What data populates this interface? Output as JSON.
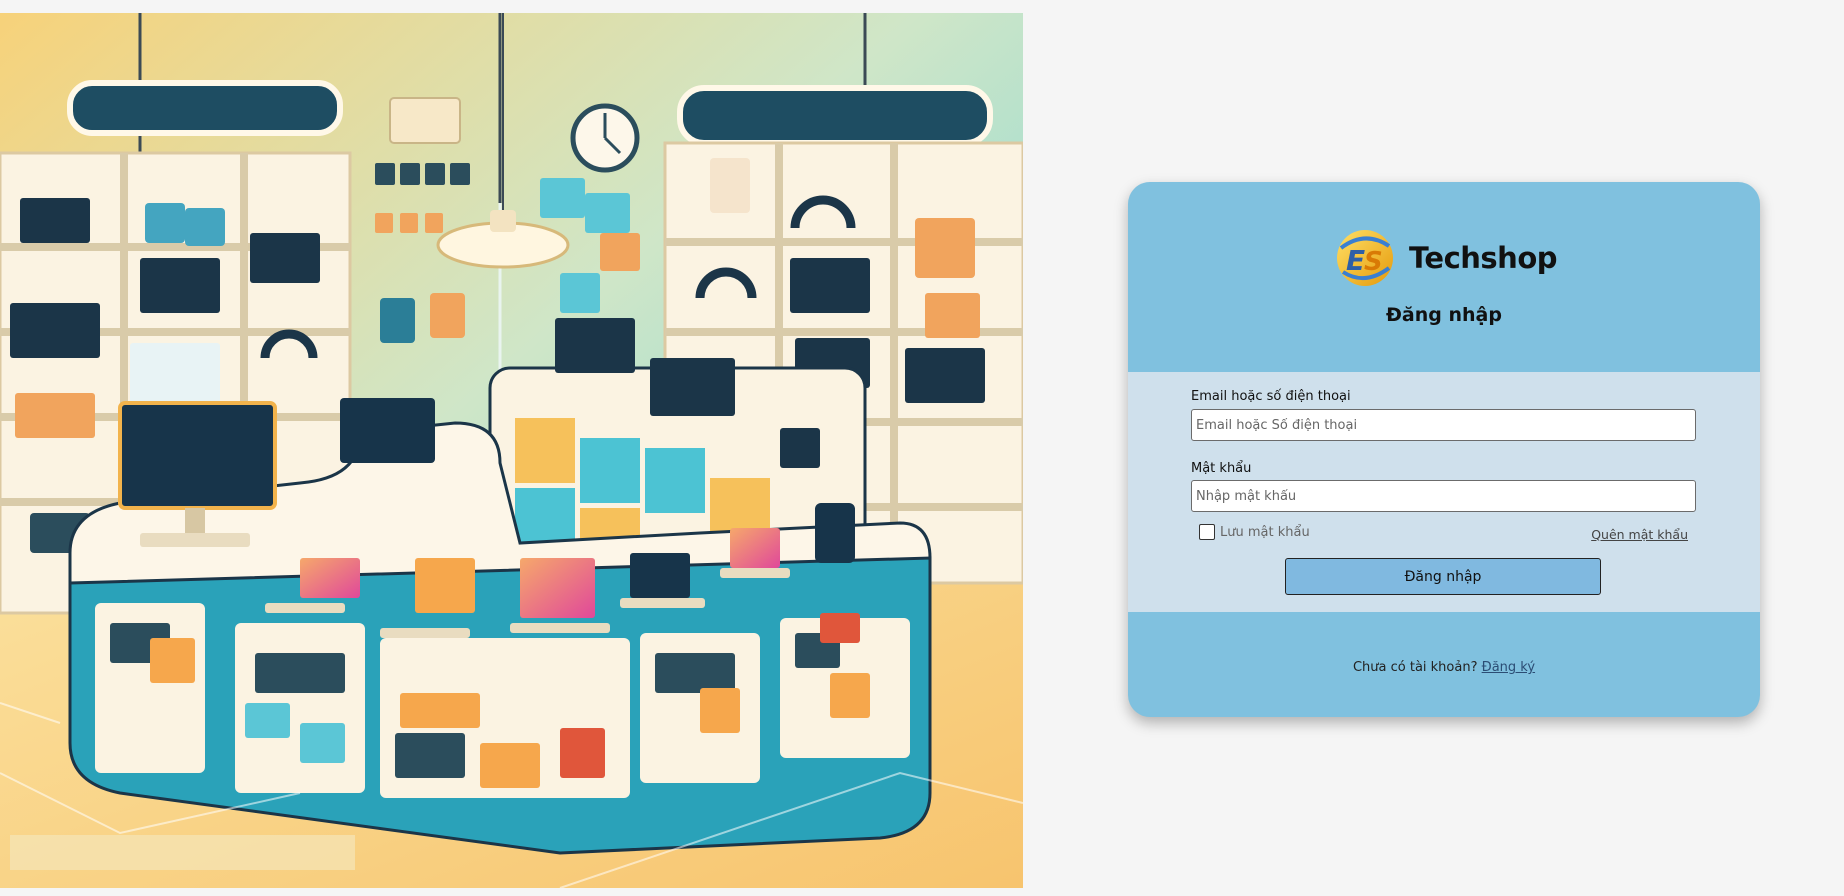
{
  "hero": {
    "alt": "Techshop electronics store illustration"
  },
  "brand": {
    "name": "Techshop",
    "logo_icon": "techshop-logo-icon"
  },
  "login": {
    "title": "Đăng nhập",
    "email_label": "Email hoặc số điện thoại",
    "email_placeholder": "Email hoặc Số điện thoại",
    "email_value": "",
    "password_label": "Mật khẩu",
    "password_placeholder": "Nhập mật khẩu",
    "password_value": "",
    "remember_label": "Lưu mật khẩu",
    "remember_checked": false,
    "forgot_label": "Quên mật khẩu",
    "submit_label": "Đăng nhập",
    "no_account_text": "Chưa có tài khoản?",
    "signup_label": "Đăng ký"
  },
  "colors": {
    "card_bg": "#80c1df",
    "card_body_bg": "#cfe0ec",
    "button_bg": "#80b9e0",
    "page_bg": "#f5f5f5"
  }
}
